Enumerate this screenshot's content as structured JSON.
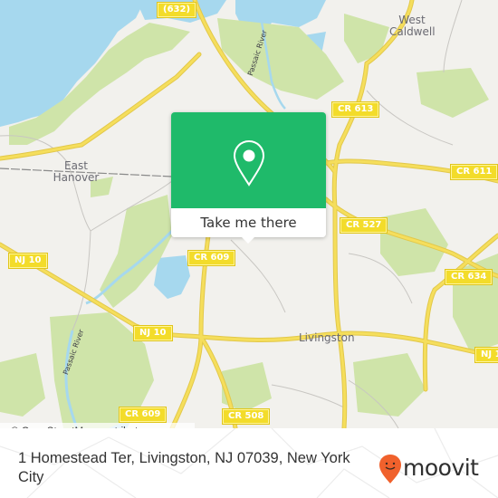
{
  "map": {
    "places": [
      {
        "id": "west-caldwell",
        "lines": [
          "West",
          "Caldwell"
        ]
      },
      {
        "id": "east-hanover",
        "lines": [
          "East",
          "Hanover"
        ]
      },
      {
        "id": "livingston",
        "lines": [
          "Livingston"
        ]
      }
    ],
    "road_shields": [
      {
        "id": "632",
        "label": "(632)"
      },
      {
        "id": "cr-613",
        "label": "CR 613"
      },
      {
        "id": "cr-611",
        "label": "CR 611"
      },
      {
        "id": "cr-527",
        "label": "CR 527"
      },
      {
        "id": "cr-634",
        "label": "CR 634"
      },
      {
        "id": "cr-609-north",
        "label": "CR 609"
      },
      {
        "id": "nj-10-west",
        "label": "NJ 10"
      },
      {
        "id": "nj-10-center",
        "label": "NJ 10"
      },
      {
        "id": "nj-10-east",
        "label": "NJ 1"
      },
      {
        "id": "cr-609-south",
        "label": "CR 609"
      },
      {
        "id": "cr-508",
        "label": "CR 508"
      }
    ],
    "rivers": [
      {
        "id": "passaic-river-north",
        "label": "Passaic River"
      },
      {
        "id": "passaic-river-south",
        "label": "Passaic River"
      }
    ],
    "attribution": "© OpenStreetMap contributors",
    "colors": {
      "land": "#f2f1ed",
      "park": "#cfe4a9",
      "water": "#a6d8ee",
      "road": "#f5de5c",
      "shield": "#f3dc2a"
    }
  },
  "popup": {
    "icon": "location-pin-icon",
    "button_label": "Take me there",
    "color": "#1fba6a"
  },
  "footer": {
    "address": "1 Homestead Ter, Livingston, NJ 07039, New York City",
    "brand": "moovit",
    "brand_color": "#f0612c"
  }
}
